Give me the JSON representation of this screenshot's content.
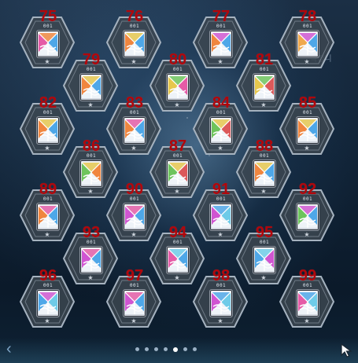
{
  "background_text": "삭집니",
  "pager": {
    "total_pages": 7,
    "current_page": 5,
    "prev_icon": "chevron-left-icon",
    "next_icon": "cursor-arrow-icon"
  },
  "slot_code": "001",
  "slots": [
    {
      "number": "75",
      "bands": [
        "#e34a9c",
        "#f07a2a",
        "#3c9ee6"
      ]
    },
    {
      "number": "76",
      "bands": [
        "#f07a2a",
        "#e4c23a",
        "#3c9ee6"
      ]
    },
    {
      "number": "77",
      "bands": [
        "#f07a2a",
        "#cc44cc",
        "#3c9ee6"
      ]
    },
    {
      "number": "78",
      "bands": [
        "#f0a13a",
        "#cc44cc",
        "#3c9ee6"
      ]
    },
    {
      "number": "79",
      "bands": [
        "#f07a2a",
        "#e4c23a",
        "#3c9ee6"
      ]
    },
    {
      "number": "80",
      "bands": [
        "#e4c23a",
        "#5fbf4a",
        "#e34a9c"
      ]
    },
    {
      "number": "81",
      "bands": [
        "#e4c23a",
        "#5fbf4a",
        "#d94848"
      ]
    },
    {
      "number": "82",
      "bands": [
        "#f07a2a",
        "#e4c23a",
        "#3c9ee6"
      ]
    },
    {
      "number": "83",
      "bands": [
        "#f07a2a",
        "#e34a9c",
        "#3c9ee6"
      ]
    },
    {
      "number": "84",
      "bands": [
        "#5fbf4a",
        "#e4c23a",
        "#d94848"
      ]
    },
    {
      "number": "85",
      "bands": [
        "#f07a2a",
        "#e4c23a",
        "#3c9ee6"
      ]
    },
    {
      "number": "86",
      "bands": [
        "#5fbf4a",
        "#e4c23a",
        "#f07a2a"
      ]
    },
    {
      "number": "87",
      "bands": [
        "#5fbf4a",
        "#e4c23a",
        "#d94848"
      ]
    },
    {
      "number": "88",
      "bands": [
        "#f07a2a",
        "#e4c23a",
        "#3c9ee6"
      ]
    },
    {
      "number": "89",
      "bands": [
        "#f07a2a",
        "#e34a9c",
        "#3c9ee6"
      ]
    },
    {
      "number": "90",
      "bands": [
        "#cc44cc",
        "#e34a9c",
        "#3c9ee6"
      ]
    },
    {
      "number": "91",
      "bands": [
        "#cc44cc",
        "#3c9ee6",
        "#5fc7e6"
      ]
    },
    {
      "number": "92",
      "bands": [
        "#5fbf4a",
        "#cc44cc",
        "#3c9ee6"
      ]
    },
    {
      "number": "93",
      "bands": [
        "#cc44cc",
        "#e34a9c",
        "#3c9ee6"
      ]
    },
    {
      "number": "94",
      "bands": [
        "#e34a9c",
        "#5fc7e6",
        "#3c9ee6"
      ]
    },
    {
      "number": "95",
      "bands": [
        "#3c9ee6",
        "#5fc7e6",
        "#cc44cc"
      ]
    },
    {
      "number": "96",
      "bands": [
        "#3c9ee6",
        "#cc44cc",
        "#5fc7e6"
      ]
    },
    {
      "number": "97",
      "bands": [
        "#cc44cc",
        "#e34a9c",
        "#3c9ee6"
      ]
    },
    {
      "number": "98",
      "bands": [
        "#cc44cc",
        "#3c9ee6",
        "#5fc7e6"
      ]
    },
    {
      "number": "99",
      "bands": [
        "#e34a9c",
        "#3c9ee6",
        "#5fc7e6"
      ]
    }
  ],
  "colors": {
    "number_red": "#b1060b",
    "hex_fill": "#3c4650",
    "hex_border": "#a5b2bf"
  }
}
